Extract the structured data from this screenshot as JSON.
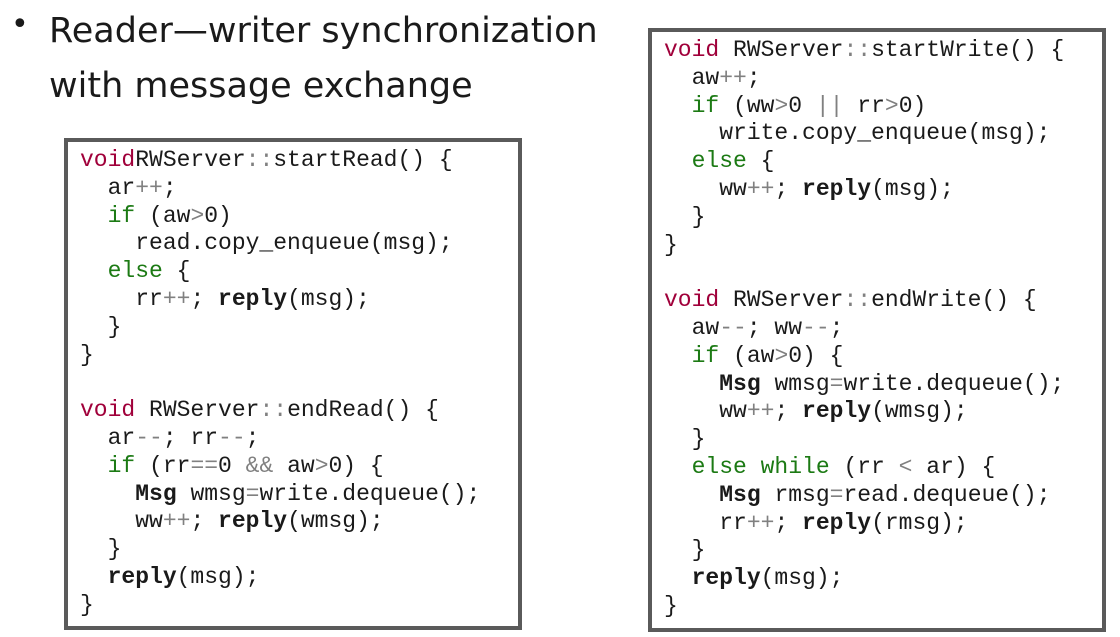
{
  "slide": {
    "bullet": "•",
    "title_line1": "Reader—writer synchronization",
    "title_line2": "with message exchange"
  },
  "left_code": [
    [
      [
        "k",
        "void"
      ],
      [
        "",
        "RWServer"
      ],
      [
        "o",
        "::"
      ],
      [
        "",
        "startRead() {"
      ]
    ],
    [
      [
        "",
        "  ar"
      ],
      [
        "o",
        "++"
      ],
      [
        "",
        ";"
      ]
    ],
    [
      [
        "g",
        "  if"
      ],
      [
        "",
        ""
      ],
      [
        "",
        ""
      ],
      [
        "",
        ""
      ],
      [
        "",
        " (aw"
      ],
      [
        "o",
        ">"
      ],
      [
        "",
        "0)"
      ]
    ],
    [
      [
        "",
        "    read.copy_enqueue(msg);"
      ]
    ],
    [
      [
        "g",
        "  else"
      ],
      [
        "",
        " {"
      ]
    ],
    [
      [
        "",
        "    rr"
      ],
      [
        "o",
        "++"
      ],
      [
        "",
        "; "
      ],
      [
        "b",
        "reply"
      ],
      [
        "",
        "(msg);"
      ]
    ],
    [
      [
        "",
        "  }"
      ]
    ],
    [
      [
        "",
        "}"
      ]
    ],
    [
      [
        "",
        ""
      ]
    ],
    [
      [
        "k",
        "void"
      ],
      [
        "",
        " RWServer"
      ],
      [
        "o",
        "::"
      ],
      [
        "",
        "endRead() {"
      ]
    ],
    [
      [
        "",
        "  ar"
      ],
      [
        "o",
        "--"
      ],
      [
        "",
        "; rr"
      ],
      [
        "o",
        "--"
      ],
      [
        "",
        ";"
      ]
    ],
    [
      [
        "g",
        "  if"
      ],
      [
        "",
        " (rr"
      ],
      [
        "o",
        "=="
      ],
      [
        "",
        "0 "
      ],
      [
        "o",
        "&&"
      ],
      [
        "",
        " aw"
      ],
      [
        "o",
        ">"
      ],
      [
        "",
        "0) {"
      ]
    ],
    [
      [
        "",
        "    "
      ],
      [
        "b",
        "Msg"
      ],
      [
        "",
        " wmsg"
      ],
      [
        "o",
        "="
      ],
      [
        "",
        "write.dequeue();"
      ]
    ],
    [
      [
        "",
        "    ww"
      ],
      [
        "o",
        "++"
      ],
      [
        "",
        "; "
      ],
      [
        "b",
        "reply"
      ],
      [
        "",
        "(wmsg);"
      ]
    ],
    [
      [
        "",
        "  }"
      ]
    ],
    [
      [
        "",
        "  "
      ],
      [
        "b",
        "reply"
      ],
      [
        "",
        "(msg);"
      ]
    ],
    [
      [
        "",
        "}"
      ]
    ]
  ],
  "right_code": [
    [
      [
        "k",
        "void"
      ],
      [
        "",
        " RWServer"
      ],
      [
        "o",
        "::"
      ],
      [
        "",
        "startWrite() {"
      ]
    ],
    [
      [
        "",
        "  aw"
      ],
      [
        "o",
        "++"
      ],
      [
        "",
        ";"
      ]
    ],
    [
      [
        "g",
        "  if"
      ],
      [
        "",
        " (ww"
      ],
      [
        "o",
        ">"
      ],
      [
        "",
        "0 "
      ],
      [
        "o",
        "||"
      ],
      [
        "",
        " rr"
      ],
      [
        "o",
        ">"
      ],
      [
        "",
        "0)"
      ]
    ],
    [
      [
        "",
        "    write.copy_enqueue(msg);"
      ]
    ],
    [
      [
        "g",
        "  else"
      ],
      [
        "",
        " {"
      ]
    ],
    [
      [
        "",
        "    ww"
      ],
      [
        "o",
        "++"
      ],
      [
        "",
        "; "
      ],
      [
        "b",
        "reply"
      ],
      [
        "",
        "(msg);"
      ]
    ],
    [
      [
        "",
        "  }"
      ]
    ],
    [
      [
        "",
        "}"
      ]
    ],
    [
      [
        "",
        ""
      ]
    ],
    [
      [
        "k",
        "void"
      ],
      [
        "",
        " RWServer"
      ],
      [
        "o",
        "::"
      ],
      [
        "",
        "endWrite() {"
      ]
    ],
    [
      [
        "",
        "  aw"
      ],
      [
        "o",
        "--"
      ],
      [
        "",
        "; ww"
      ],
      [
        "o",
        "--"
      ],
      [
        "",
        ";"
      ]
    ],
    [
      [
        "g",
        "  if"
      ],
      [
        "",
        " (aw"
      ],
      [
        "o",
        ">"
      ],
      [
        "",
        "0) {"
      ]
    ],
    [
      [
        "",
        "    "
      ],
      [
        "b",
        "Msg"
      ],
      [
        "",
        " wmsg"
      ],
      [
        "o",
        "="
      ],
      [
        "",
        "write.dequeue();"
      ]
    ],
    [
      [
        "",
        "    ww"
      ],
      [
        "o",
        "++"
      ],
      [
        "",
        "; "
      ],
      [
        "b",
        "reply"
      ],
      [
        "",
        "(wmsg);"
      ]
    ],
    [
      [
        "",
        "  }"
      ]
    ],
    [
      [
        "g",
        "  else while"
      ],
      [
        "",
        " (rr "
      ],
      [
        "o",
        "<"
      ],
      [
        "",
        " ar) {"
      ]
    ],
    [
      [
        "",
        "    "
      ],
      [
        "b",
        "Msg"
      ],
      [
        "",
        " rmsg"
      ],
      [
        "o",
        "="
      ],
      [
        "",
        "read.dequeue();"
      ]
    ],
    [
      [
        "",
        "    rr"
      ],
      [
        "o",
        "++"
      ],
      [
        "",
        "; "
      ],
      [
        "b",
        "reply"
      ],
      [
        "",
        "(rmsg);"
      ]
    ],
    [
      [
        "",
        "  }"
      ]
    ],
    [
      [
        "",
        "  "
      ],
      [
        "b",
        "reply"
      ],
      [
        "",
        "(msg);"
      ]
    ],
    [
      [
        "",
        "}"
      ]
    ]
  ]
}
